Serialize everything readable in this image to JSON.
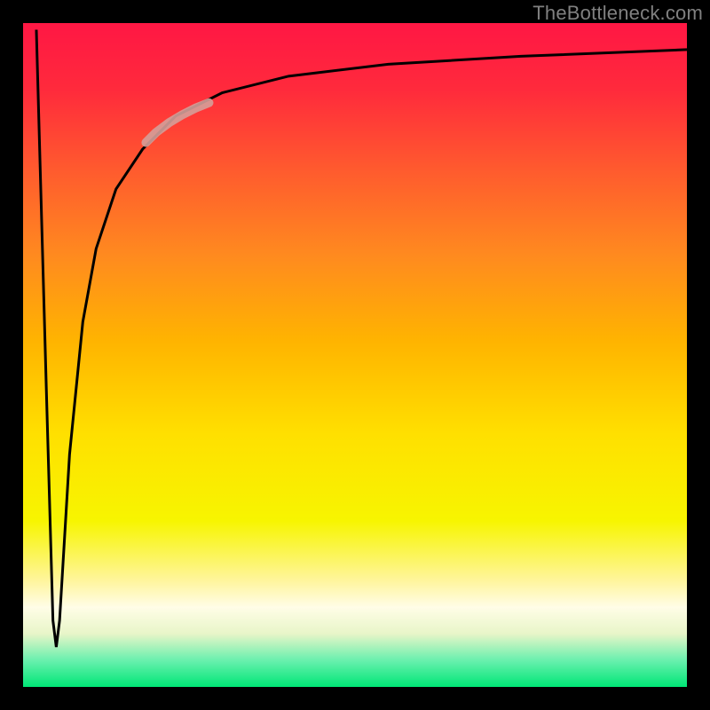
{
  "watermark": "TheBottleneck.com",
  "chart_data": {
    "type": "line",
    "title": "",
    "xlabel": "",
    "ylabel": "",
    "xlim": [
      0,
      100
    ],
    "ylim": [
      0,
      100
    ],
    "axes": {
      "box_color": "#000000",
      "background_gradient": {
        "type": "vertical",
        "stops": [
          {
            "offset": 0.0,
            "color": "#ff1744"
          },
          {
            "offset": 0.1,
            "color": "#ff2a3c"
          },
          {
            "offset": 0.22,
            "color": "#ff5a2e"
          },
          {
            "offset": 0.35,
            "color": "#ff8a1f"
          },
          {
            "offset": 0.48,
            "color": "#ffb400"
          },
          {
            "offset": 0.62,
            "color": "#ffe000"
          },
          {
            "offset": 0.75,
            "color": "#f7f500"
          },
          {
            "offset": 0.84,
            "color": "#fff59d"
          },
          {
            "offset": 0.88,
            "color": "#fffde7"
          },
          {
            "offset": 0.92,
            "color": "#e8f5c8"
          },
          {
            "offset": 0.96,
            "color": "#69f0ae"
          },
          {
            "offset": 1.0,
            "color": "#00e676"
          }
        ]
      }
    },
    "series": [
      {
        "name": "bottleneck-curve",
        "stroke": "#000000",
        "stroke_width": 3,
        "x": [
          2.0,
          3.5,
          4.5,
          5.0,
          5.5,
          7.0,
          9.0,
          11.0,
          14.0,
          18.0,
          23.0,
          30.0,
          40.0,
          55.0,
          75.0,
          100.0
        ],
        "values": [
          99.0,
          45.0,
          10.0,
          6.0,
          10.0,
          35.0,
          55.0,
          66.0,
          75.0,
          81.0,
          86.0,
          89.5,
          92.0,
          93.8,
          95.0,
          96.0
        ]
      },
      {
        "name": "highlight-segment",
        "stroke": "#d59e99",
        "stroke_width": 10,
        "opacity": 0.9,
        "x": [
          18.5,
          20.0,
          22.0,
          24.0,
          26.0,
          28.0
        ],
        "values": [
          82.0,
          83.5,
          85.0,
          86.2,
          87.2,
          88.0
        ]
      }
    ]
  }
}
